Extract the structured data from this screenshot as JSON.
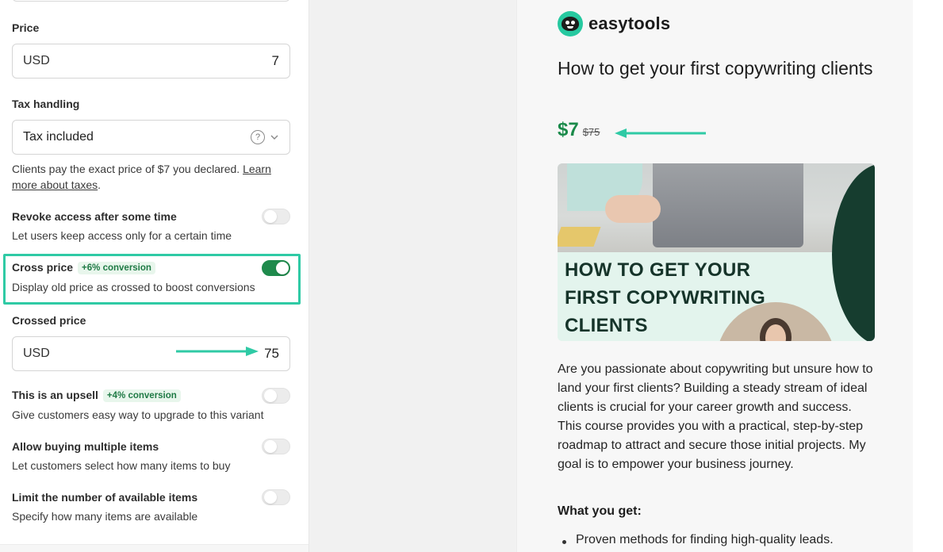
{
  "settings": {
    "price": {
      "label": "Price",
      "currency": "USD",
      "amount": "7"
    },
    "tax": {
      "label": "Tax handling",
      "value": "Tax included",
      "help_glyph": "?",
      "description_prefix": "Clients pay the exact price of $7 you declared. ",
      "learn_more": "Learn more about taxes",
      "description_suffix": "."
    },
    "revoke": {
      "label": "Revoke access after some time",
      "description": "Let users keep access only for a certain time",
      "enabled": false
    },
    "cross_price": {
      "label": "Cross price",
      "badge": "+6% conversion",
      "description": "Display old price as crossed to boost conversions",
      "enabled": true
    },
    "crossed_price": {
      "label": "Crossed price",
      "currency": "USD",
      "amount": "75"
    },
    "upsell": {
      "label": "This is an upsell",
      "badge": "+4% conversion",
      "description": "Give customers easy way to upgrade to this variant",
      "enabled": false
    },
    "multiple": {
      "label": "Allow buying multiple items",
      "description": "Let customers select how many items to buy",
      "enabled": false
    },
    "limit": {
      "label": "Limit the number of available items",
      "description": "Specify how many items are available",
      "enabled": false
    }
  },
  "preview": {
    "brand": "easytools",
    "title": "How to get your first copywriting clients",
    "price_now": "$7",
    "price_old": "$75",
    "cover_lines": [
      "HOW TO GET YOUR",
      "FIRST COPYWRITING",
      "CLIENTS"
    ],
    "body": "Are you passionate about copywriting but unsure how to land your first clients? Building a steady stream of ideal clients is crucial for your career growth and success. This course provides you with a practical, step-by-step roadmap to attract and secure those initial projects. My goal is to empower your business journey.",
    "what_you_get": "What you get:",
    "bullets": [
      "Proven methods for finding high-quality leads."
    ]
  },
  "colors": {
    "accent_green": "#1a8a4a",
    "highlight_teal": "#2fcaa5",
    "toggle_on": "#1f8a4c"
  },
  "icons": {
    "help": "question-circle-icon",
    "dropdown": "chevron-down-icon",
    "arrow": "arrow-annotation-icon"
  }
}
